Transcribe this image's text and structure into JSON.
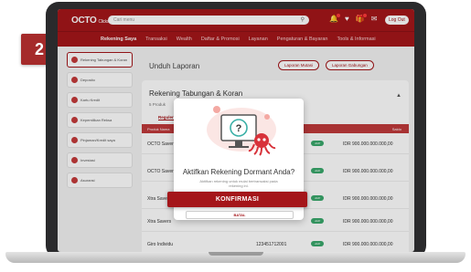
{
  "step": "2",
  "header": {
    "logo": "OCTO",
    "logo_sub": "Clicks",
    "search_placeholder": "Cari menu",
    "logout": "Log Out"
  },
  "nav": {
    "items": [
      "Rekening Saya",
      "Transaksi",
      "Wealth",
      "Daftar & Promosi",
      "Layanan",
      "Pengaturan & Bayaran",
      "Tools & Informasi"
    ]
  },
  "sidebar": {
    "items": [
      "Rekening Tabungan & Koran",
      "Deposito",
      "Kartu Kredit",
      "Kepemilikan Reksa",
      "Pinjaman/Kredit saya",
      "Investasi",
      "Asuransi"
    ]
  },
  "main": {
    "title": "Unduh Laporan",
    "btn_mutasi": "Laporan Mutasi",
    "btn_gabungan": "Laporan Gabungan",
    "card_title": "Rekening Tabungan & Koran",
    "card_sub": "5 Produk",
    "tab_regular": "Reguler",
    "col_product": "Produk Nama",
    "col_balance": "Saldo",
    "rows": [
      {
        "name": "OCTO Saver",
        "balance": "IDR 900.000.000.000,00"
      },
      {
        "name": "OCTO Saver",
        "balance": "IDR 900.000.000.000,00"
      },
      {
        "name": "Xtra Savers",
        "balance": "IDR 900.000.000.000,00"
      },
      {
        "name": "Xtra Savers",
        "balance": "IDR 900.000.000.000,00"
      },
      {
        "name": "Giro Individu",
        "account": "123451712001",
        "balance": "IDR 900.000.000.000,00"
      }
    ],
    "status_pill": "Aktif"
  },
  "modal": {
    "title": "Aktifkan Rekening Dormant Anda?",
    "description": "Aktifkan rekening untuk mulai bertransaksi pada rekening ini.",
    "confirm": "KONFIRMASI",
    "cancel": "BATAL"
  },
  "colors": {
    "brand": "#a4161a",
    "step_badge": "#a52a2a",
    "status_green": "#39a86b"
  },
  "icons": [
    "search-icon",
    "notification-icon",
    "heart-icon",
    "gift-icon",
    "mail-icon",
    "question-icon",
    "monitor-icon",
    "octopus-mascot-icon",
    "chevron-up-icon"
  ]
}
